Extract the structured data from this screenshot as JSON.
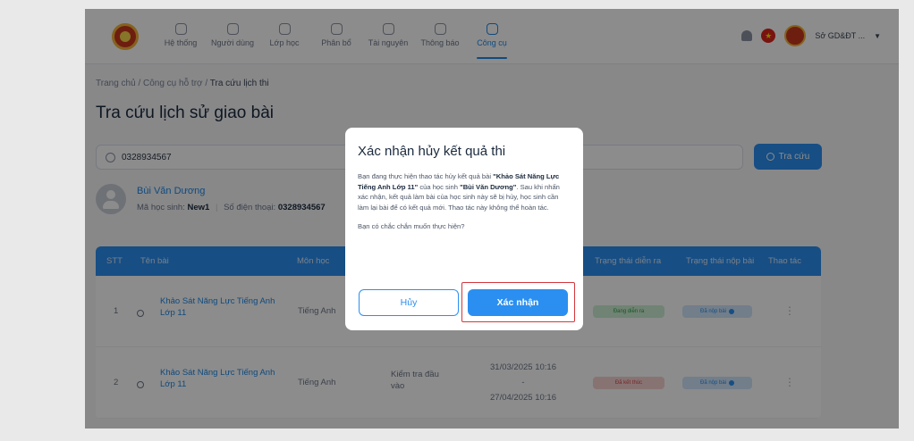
{
  "header": {
    "nav": [
      {
        "label": "Hệ thống",
        "active": false
      },
      {
        "label": "Người dùng",
        "active": false
      },
      {
        "label": "Lớp học",
        "active": false
      },
      {
        "label": "Phân bổ",
        "active": false
      },
      {
        "label": "Tài nguyên",
        "active": false
      },
      {
        "label": "Thông báo",
        "active": false
      },
      {
        "label": "Công cụ",
        "active": true
      }
    ],
    "user_name": "Sở GD&ĐT ...",
    "icons": [
      "bell-icon",
      "vietnam-flag-icon",
      "chevron-down-icon"
    ]
  },
  "breadcrumb": {
    "items": [
      "Trang chủ",
      "Công cụ hỗ trợ",
      "Tra cứu lịch thi"
    ],
    "separator": "/"
  },
  "page_title": "Tra cứu lịch sử giao bài",
  "search": {
    "value": "0328934567",
    "button_label": "Tra cứu"
  },
  "student": {
    "name": "Bùi Văn Dương",
    "code_label": "Mã học sinh:",
    "code": "New1",
    "phone_label": "Số điện thoại:",
    "phone": "0328934567"
  },
  "table": {
    "headers": {
      "stt": "STT",
      "name": "Tên bài",
      "subject": "Môn học",
      "status": "Trạng thái diễn ra",
      "submit": "Trạng thái nộp bài",
      "actions": "Thao tác"
    },
    "rows": [
      {
        "stt": "1",
        "name_line1": "Khảo Sát Năng Lực Tiếng Anh",
        "name_line2": "Lớp 11",
        "subject": "Tiếng Anh",
        "type": "",
        "start": "",
        "dash": "",
        "end": "",
        "status": "Đang diễn ra",
        "submit": "Đã nộp bài",
        "actions": "⋮"
      },
      {
        "stt": "2",
        "name_line1": "Khảo Sát Năng Lực Tiếng Anh",
        "name_line2": "Lớp 11",
        "subject": "Tiếng Anh",
        "type_line1": "Kiểm tra đầu",
        "type_line2": "vào",
        "start": "31/03/2025 10:16",
        "dash": "-",
        "end": "27/04/2025 10:16",
        "status": "Đã kết thúc",
        "submit": "Đã nộp bài",
        "actions": "⋮"
      }
    ]
  },
  "modal": {
    "title": "Xác nhận hủy kết quả thi",
    "body_1": "Bạn đang thực hiện thao tác hủy kết quả bài ",
    "test_name": "\"Khảo Sát Năng Lực Tiếng Anh Lớp 11\"",
    "body_2": " của học sinh ",
    "student_name": "\"Bùi Văn Dương\"",
    "body_3": ". Sau khi nhấn xác nhận, kết quả làm bài của học sinh này sẽ bị hủy, học sinh cần làm lại bài để có kết quả mới. Thao tác này không thể hoàn tác.",
    "question": "Bạn có chắc chắn muốn thực hiện?",
    "cancel_label": "Hủy",
    "confirm_label": "Xác nhận"
  },
  "colors": {
    "primary": "#2a8ff0",
    "highlight": "#d4363b",
    "overlay": "rgba(0,0,0,0.45)"
  }
}
